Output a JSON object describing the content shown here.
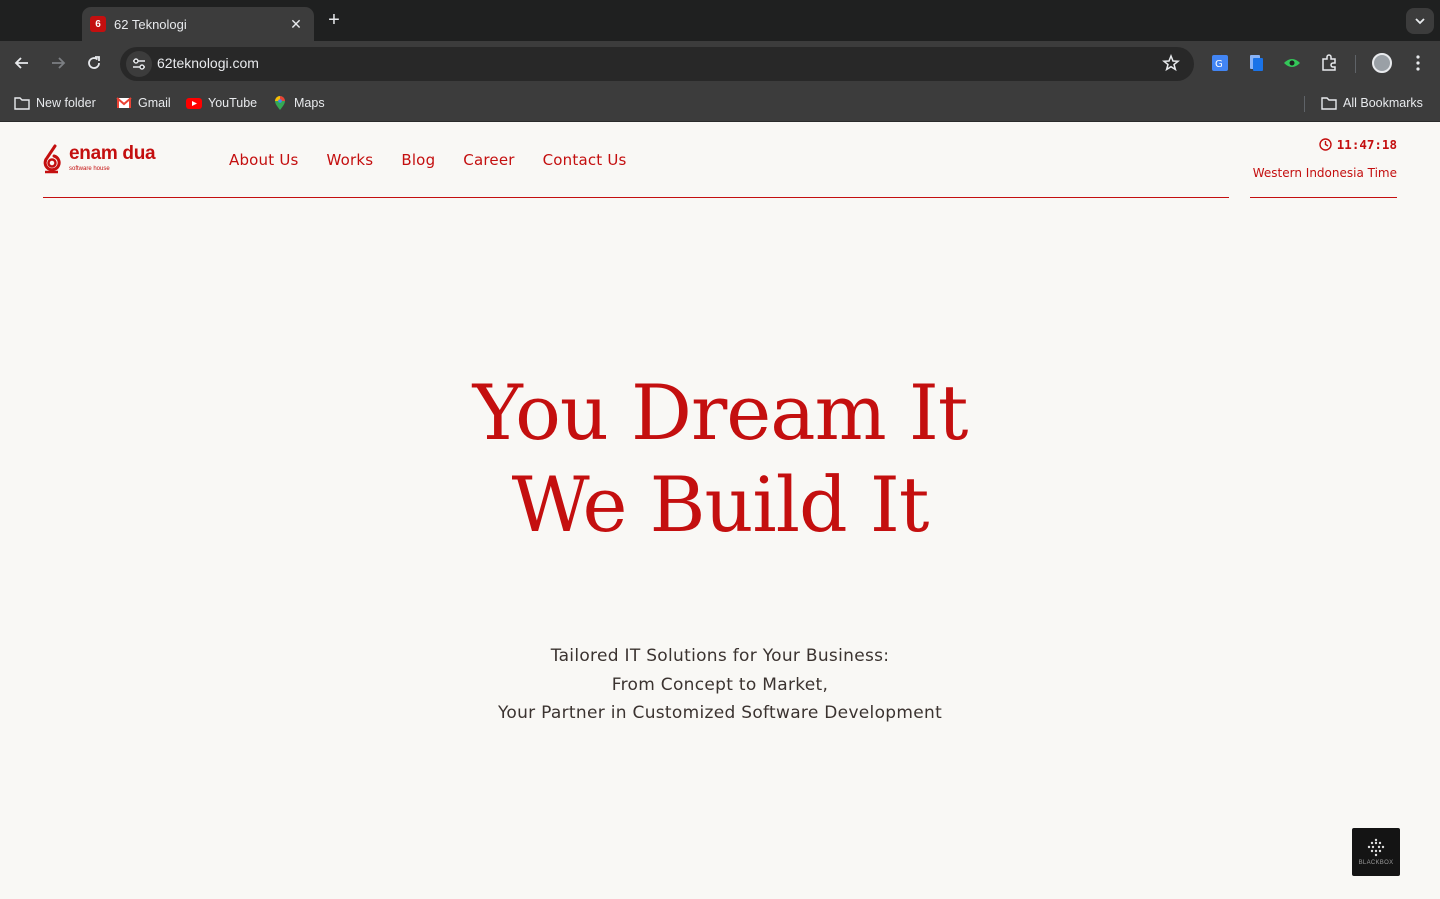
{
  "browser": {
    "tab_title": "62 Teknologi",
    "tab_favicon_text": "6",
    "url": "62teknologi.com",
    "bookmarks": [
      {
        "label": "New folder",
        "icon": "folder-icon"
      },
      {
        "label": "Gmail",
        "icon": "gmail-icon"
      },
      {
        "label": "YouTube",
        "icon": "youtube-icon"
      },
      {
        "label": "Maps",
        "icon": "maps-icon"
      }
    ],
    "all_bookmarks_label": "All Bookmarks"
  },
  "site": {
    "logo": {
      "name": "enam dua",
      "tagline": "software house"
    },
    "nav": [
      "About Us",
      "Works",
      "Blog",
      "Career",
      "Contact Us"
    ],
    "clock": {
      "time": "11:47:18",
      "zone": "Western Indonesia Time"
    },
    "hero": {
      "line1": "You Dream It",
      "line2": "We Build It"
    },
    "subtitle": {
      "line1": "Tailored IT Solutions for Your Business:",
      "line2": "From Concept to Market,",
      "line3": "Your Partner in Customized Software Development"
    },
    "widget_label": "BLACKBOX"
  },
  "colors": {
    "brand": "#c40f0f",
    "page_bg": "#f9f8f5",
    "text": "#3b3330"
  }
}
